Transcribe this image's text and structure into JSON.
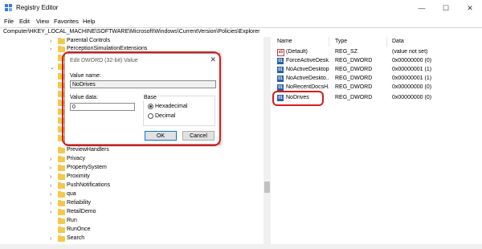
{
  "window": {
    "title": "Registry Editor",
    "minimize": "—",
    "maximize": "☐",
    "close": "✕"
  },
  "menu": [
    "File",
    "Edit",
    "View",
    "Favorites",
    "Help"
  ],
  "address": "Computer\\HKEY_LOCAL_MACHINE\\SOFTWARE\\Microsoft\\Windows\\CurrentVersion\\Policies\\Explorer",
  "tree": [
    {
      "label": "Parental Controls",
      "chevron": "›"
    },
    {
      "label": "PerceptionSimulationExtensions",
      "chevron": "›"
    },
    {
      "label": "PreviewHandlers",
      "chevron": ""
    },
    {
      "label": "Privacy",
      "chevron": "›"
    },
    {
      "label": "PropertySystem",
      "chevron": "›"
    },
    {
      "label": "Proximity",
      "chevron": "›"
    },
    {
      "label": "PushNotifications",
      "chevron": "›"
    },
    {
      "label": "qua",
      "chevron": "›"
    },
    {
      "label": "Reliability",
      "chevron": "›"
    },
    {
      "label": "RetailDemo",
      "chevron": "›"
    },
    {
      "label": "Run",
      "chevron": ""
    },
    {
      "label": "RunOnce",
      "chevron": ""
    },
    {
      "label": "Search",
      "chevron": "›"
    }
  ],
  "list": {
    "headers": {
      "name": "Name",
      "type": "Type",
      "data": "Data"
    },
    "rows": [
      {
        "icon": "ab",
        "name": "(Default)",
        "type": "REG_SZ",
        "data": "(value not set)"
      },
      {
        "icon": "01",
        "name": "ForceActiveDesk...",
        "type": "REG_DWORD",
        "data": "0x00000000 (0)"
      },
      {
        "icon": "01",
        "name": "NoActiveDesktop",
        "type": "REG_DWORD",
        "data": "0x00000001 (1)"
      },
      {
        "icon": "01",
        "name": "NoActiveDeskto...",
        "type": "REG_DWORD",
        "data": "0x00000001 (1)"
      },
      {
        "icon": "01",
        "name": "NoRecentDocsH...",
        "type": "REG_DWORD",
        "data": "0x00000000 (0)"
      },
      {
        "icon": "01",
        "name": "NoDrives",
        "type": "REG_DWORD",
        "data": "0x00000000 (0)"
      }
    ]
  },
  "dialog": {
    "title": "Edit DWORD (32-bit) Value",
    "close": "✕",
    "value_name_label": "Value name:",
    "value_name": "NoDrives",
    "value_data_label": "Value data:",
    "value_data": "0",
    "base_label": "Base",
    "hex_label": "Hexadecimal",
    "dec_label": "Decimal",
    "ok": "OK",
    "cancel": "Cancel"
  },
  "colors": {
    "highlight": "#d81b1b",
    "folder": "#f2c94c"
  }
}
